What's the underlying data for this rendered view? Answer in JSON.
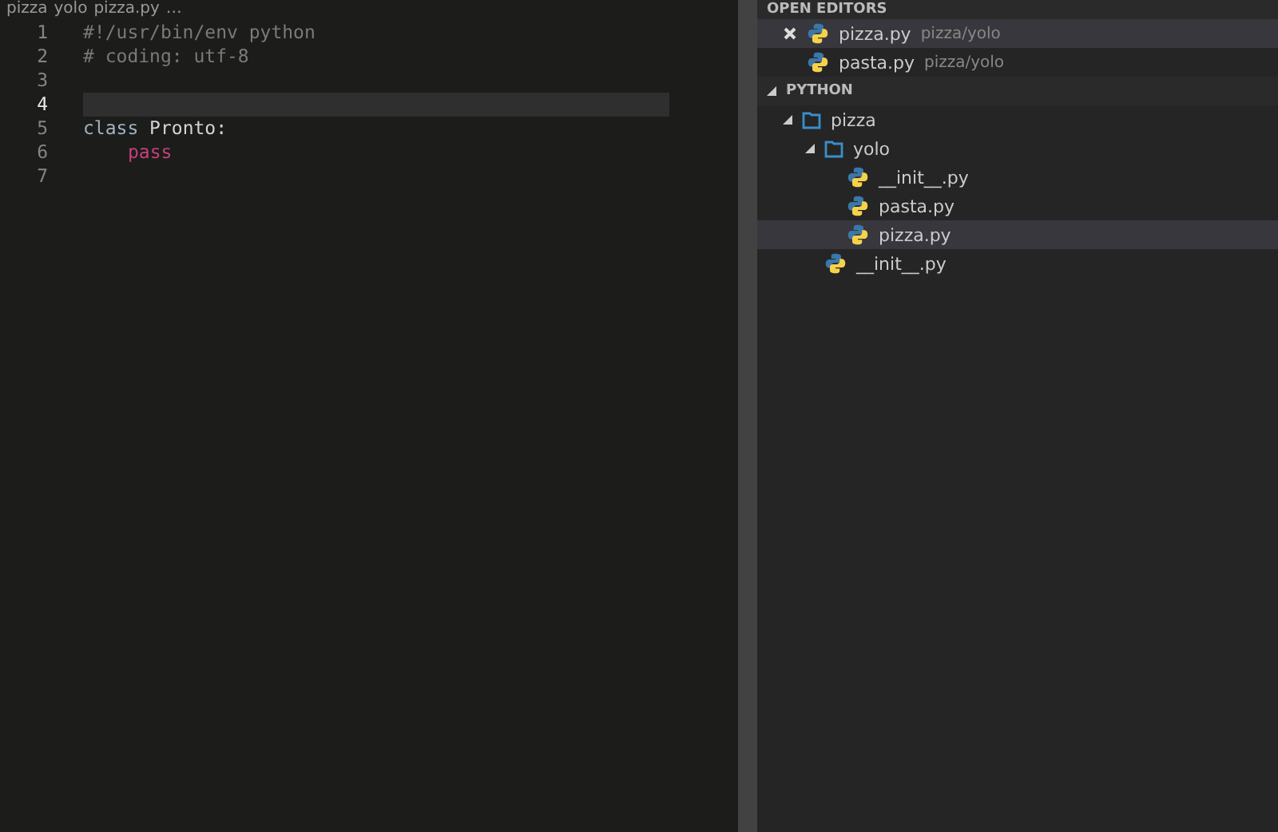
{
  "breadcrumb": [
    "pizza",
    "yolo",
    "pizza.py",
    "…"
  ],
  "editor": {
    "lines": [
      {
        "number": "1",
        "tokens": [
          {
            "kind": "comment",
            "text": "#!/usr/bin/env python"
          }
        ]
      },
      {
        "number": "2",
        "tokens": [
          {
            "kind": "comment",
            "text": "# coding: utf-8"
          }
        ]
      },
      {
        "number": "3",
        "current": false
      },
      {
        "number": "4",
        "current": true
      },
      {
        "number": "5",
        "tokens": [
          {
            "kind": "keyword",
            "text": "class"
          },
          {
            "kind": "plain",
            "text": " Pronto:"
          }
        ]
      },
      {
        "number": "6",
        "indented": true,
        "tokens": [
          {
            "kind": "control",
            "text": "pass"
          }
        ]
      },
      {
        "number": "7",
        "current": false
      }
    ]
  },
  "open_editors": {
    "title": "OPEN EDITORS",
    "items": [
      {
        "name": "pizza.py",
        "path": "pizza/yolo",
        "selected": true
      },
      {
        "name": "pasta.py",
        "path": "pizza/yolo",
        "selected": false
      }
    ]
  },
  "explorer": {
    "title": "PYTHON",
    "items": [
      {
        "kind": "folder",
        "name": "pizza",
        "expanded": true,
        "selected": false,
        "children": [
          {
            "kind": "folder",
            "name": "yolo",
            "expanded": true,
            "selected": false,
            "children": [
              {
                "kind": "file",
                "name": "__init__.py",
                "selected": false
              },
              {
                "kind": "file",
                "name": "pasta.py",
                "selected": false
              },
              {
                "kind": "file",
                "name": "pizza.py",
                "selected": true
              }
            ]
          },
          {
            "kind": "file",
            "name": "__init__.py",
            "selected": false
          }
        ]
      }
    ]
  }
}
